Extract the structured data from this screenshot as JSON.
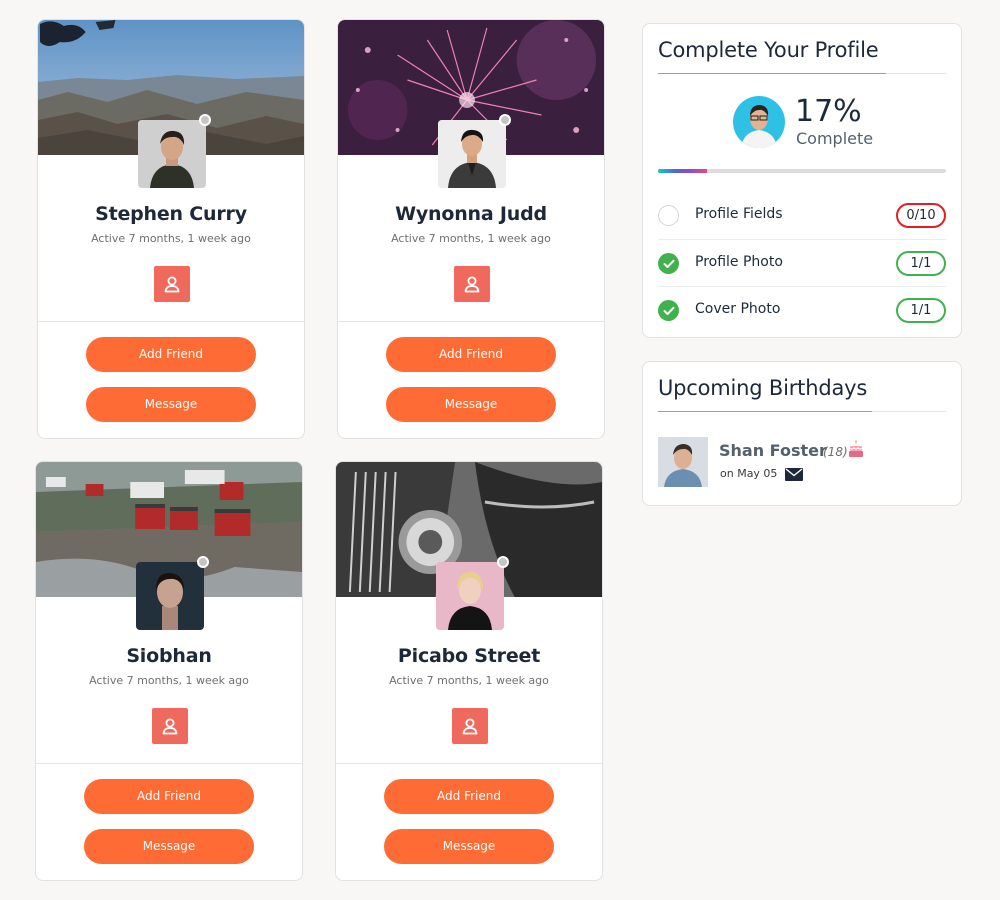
{
  "members": [
    {
      "name": "Stephen Curry",
      "active": "Active 7 months, 1 week ago",
      "add_label": "Add Friend",
      "message_label": "Message",
      "cover": "mountains-skydiver",
      "status": "offline"
    },
    {
      "name": "Wynonna Judd",
      "active": "Active 7 months, 1 week ago",
      "add_label": "Add Friend",
      "message_label": "Message",
      "cover": "fireworks",
      "status": "offline"
    },
    {
      "name": "Siobhan",
      "active": "Active 7 months, 1 week ago",
      "add_label": "Add Friend",
      "message_label": "Message",
      "cover": "red-cabins-coast",
      "status": "offline"
    },
    {
      "name": "Picabo Street",
      "active": "Active 7 months, 1 week ago",
      "add_label": "Add Friend",
      "message_label": "Message",
      "cover": "vintage-car",
      "status": "offline"
    }
  ],
  "profile_widget": {
    "title": "Complete Your Profile",
    "percent": "17%",
    "percent_label": "Complete",
    "progress": 0.17,
    "items": [
      {
        "label": "Profile Fields",
        "count": "0/10",
        "done": false
      },
      {
        "label": "Profile Photo",
        "count": "1/1",
        "done": true
      },
      {
        "label": "Cover Photo",
        "count": "1/1",
        "done": true
      }
    ]
  },
  "birthdays_widget": {
    "title": "Upcoming Birthdays",
    "person": {
      "name": "Shan Foster",
      "age": "(18)",
      "date": "on May 05"
    }
  },
  "colors": {
    "button": "#ff6b35",
    "profile_icon_bg": "#ef6a5c",
    "done_green": "#3fb24e",
    "badge_red": "#e02020",
    "title_underline": "#e08a5a",
    "page_bg": "#f8f7f5"
  },
  "icons": {
    "profile_button": "user-icon",
    "birthday": "cake-icon",
    "send_message": "envelope-icon",
    "done": "check-icon"
  }
}
